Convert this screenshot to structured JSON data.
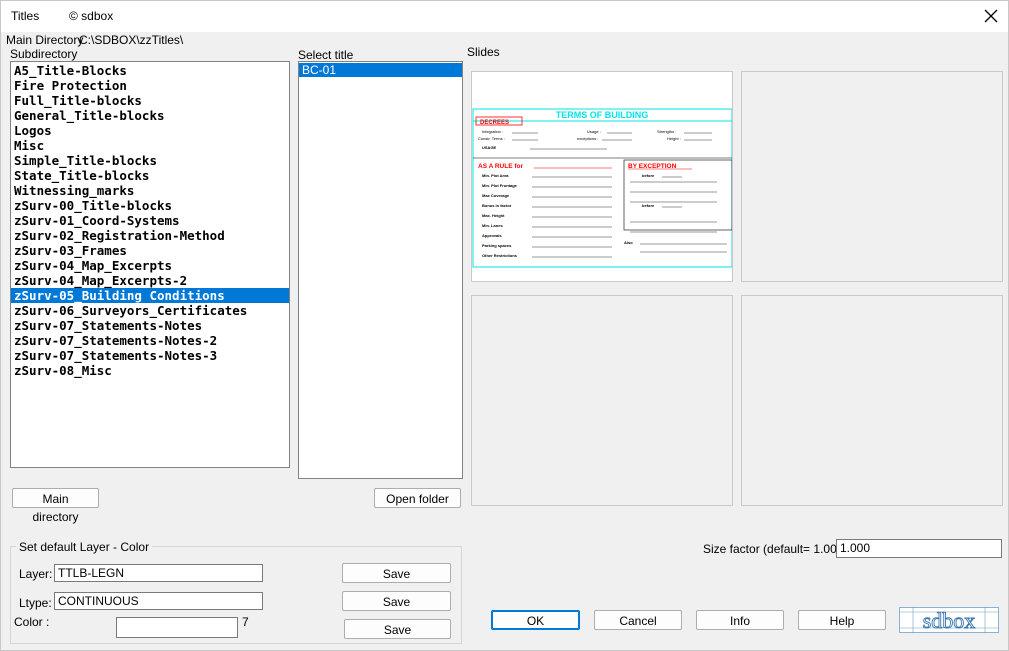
{
  "window": {
    "title": "Titles",
    "copyright": "© sdbox"
  },
  "main_directory": {
    "label": "Main Directory",
    "path": "C:\\SDBOX\\zzTitles\\"
  },
  "subdirectory": {
    "label": "Subdirectory",
    "items": [
      "A5_Title-Blocks",
      "Fire Protection",
      "Full_Title-blocks",
      "General_Title-blocks",
      "Logos",
      "Misc",
      "Simple_Title-blocks",
      "State_Title-blocks",
      "Witnessing_marks",
      "zSurv-00_Title-blocks",
      "zSurv-01_Coord-Systems",
      "zSurv-02_Registration-Method",
      "zSurv-03_Frames",
      "zSurv-04_Map_Excerpts",
      "zSurv-04_Map_Excerpts-2",
      "zSurv-05_Building Conditions",
      "zSurv-06_Surveyors_Certificates",
      "zSurv-07_Statements-Notes",
      "zSurv-07_Statements-Notes-2",
      "zSurv-07_Statements-Notes-3",
      "zSurv-08_Misc"
    ],
    "selected_index": 15
  },
  "select_title": {
    "label": "Select title",
    "items": [
      "BC-01"
    ],
    "selected_index": 0
  },
  "slides": {
    "label": "Slides",
    "preview": {
      "heading": "TERMS OF BUILDING",
      "decree": "DECREES",
      "integration": "Integration :",
      "usage_lbl": "Usage :",
      "strengths": "Strengths :",
      "constr_terms": "Constr. Terms :",
      "exceptions": "exceptions :",
      "height_lbl": "Height :",
      "usage_row": "USAGE",
      "rule_heading": "AS A RULE for",
      "exception_heading": "BY EXCEPTION",
      "rows": [
        "Min. Plot Area",
        "Min. Plot Frontage",
        "Max Coverage",
        "Bonus in factor",
        "Max. Height",
        "Min. Lanes",
        "Approvals",
        "Parking spaces",
        "Other Restrictions"
      ],
      "before": "before",
      "also": "Also"
    }
  },
  "buttons": {
    "main_directory": "Main directory",
    "open_folder": "Open folder",
    "save1": "Save",
    "save2": "Save",
    "save3": "Save",
    "ok": "OK",
    "cancel": "Cancel",
    "info": "Info",
    "help": "Help"
  },
  "layer_group": {
    "title": "Set default Layer - Color",
    "layer_label": "Layer:",
    "layer_value": "TTLB-LEGN",
    "ltype_label": "Ltype:",
    "ltype_value": "CONTINUOUS",
    "color_label": "Color  :",
    "color_value": "",
    "color_number": "7"
  },
  "size_factor": {
    "label": "Size factor  (default= 1.00):",
    "value": "1.000"
  },
  "logo": {
    "text": "sdbox"
  },
  "colors": {
    "selection": "#0078d7",
    "preview_cyan": "#00e5e5",
    "preview_red": "#ff0000"
  }
}
